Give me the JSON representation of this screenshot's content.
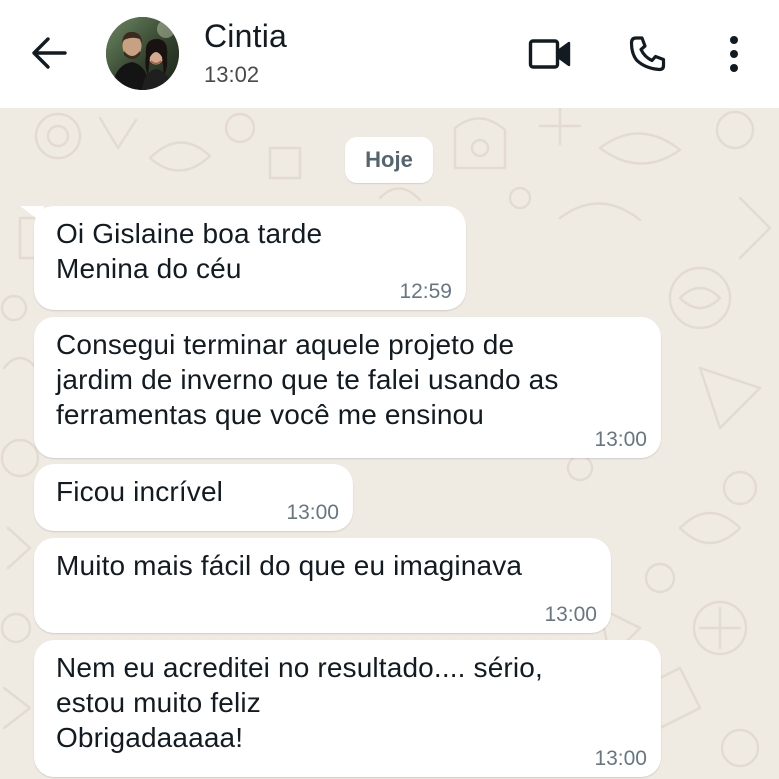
{
  "header": {
    "contact_name": "Cintia",
    "status": "13:02",
    "icons": {
      "back": "arrow-left-icon",
      "video": "video-camera-icon",
      "call": "phone-icon",
      "menu": "more-vertical-icon"
    }
  },
  "chat": {
    "date_label": "Hoje",
    "messages": [
      {
        "text": "Oi Gislaine boa tarde\nMenina do céu",
        "time": "12:59",
        "direction": "incoming"
      },
      {
        "text": "Consegui terminar aquele projeto de\njardim de inverno que te falei usando as\nferramentas que você me ensinou",
        "time": "13:00",
        "direction": "incoming"
      },
      {
        "text": "Ficou incrível",
        "time": "13:00",
        "direction": "incoming"
      },
      {
        "text": "Muito mais fácil do que eu imaginava",
        "time": "13:00",
        "direction": "incoming"
      },
      {
        "text": "Nem eu acreditei no resultado.... sério,\nestou muito feliz\nObrigadaaaaa!",
        "time": "13:00",
        "direction": "incoming"
      }
    ]
  },
  "colors": {
    "header_bg": "#ffffff",
    "wallpaper_bg": "#efeae2",
    "bubble_incoming": "#ffffff",
    "text_primary": "#111b21",
    "text_secondary": "#667781"
  }
}
